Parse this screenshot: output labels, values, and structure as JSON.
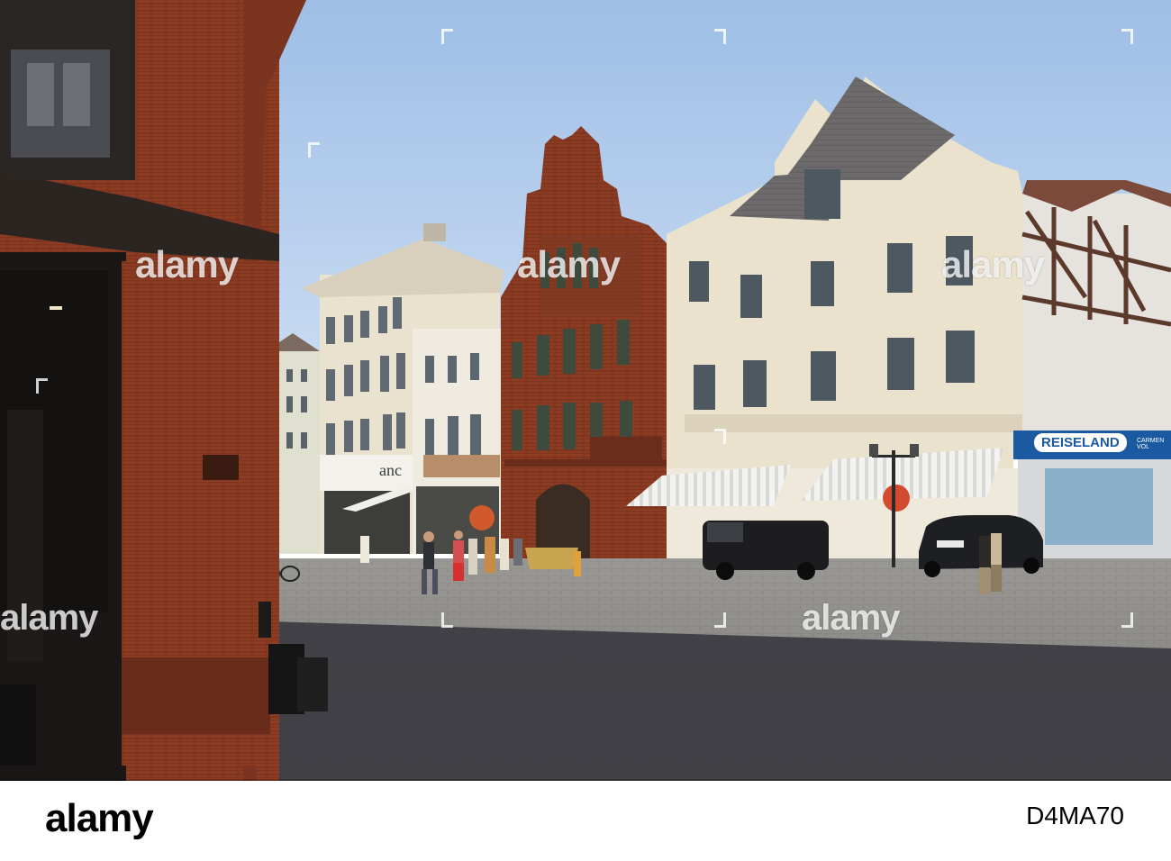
{
  "watermark": {
    "text": "alamy"
  },
  "signs": {
    "store_left": "anc",
    "travel_agency": "REISELAND",
    "travel_agency_sub": "CARMEN VOL"
  },
  "footer": {
    "logo": "alamy",
    "image_id": "D4MA70"
  },
  "colors": {
    "sky": "#a9c6ea",
    "brick": "#8a3b22",
    "cobblestone": "#8a8784",
    "shadow": "#3a3a40",
    "cream_facade": "#e8dfcc",
    "awning": "#f2f2f0",
    "footer_bg": "#ffffff"
  }
}
